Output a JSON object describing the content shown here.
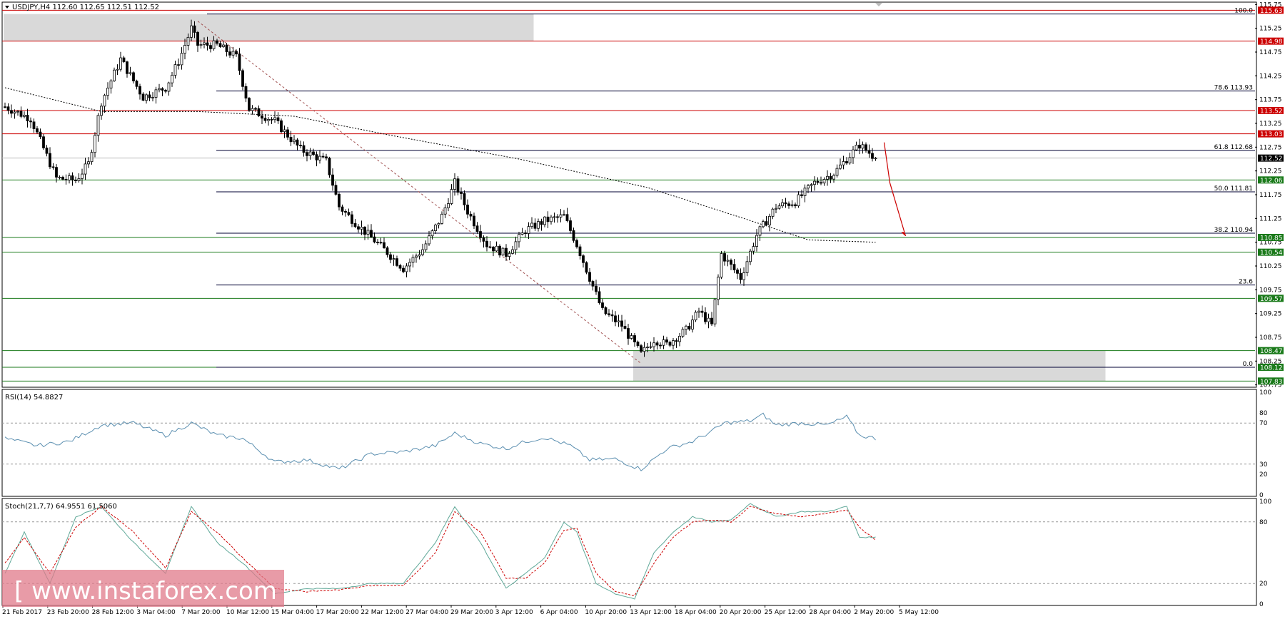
{
  "header": {
    "symbol_line": "USDJPY,H4  112.60 112.65 112.51 112.52"
  },
  "colors": {
    "bull": "#000000",
    "bear": "#000000",
    "resistance": "#cc0000",
    "support": "#1a7a1a",
    "fib": "#000033",
    "zone": "#d9d9d9",
    "rsi_line": "#5b8fb0",
    "stoch_main": "#5fa898",
    "stoch_signal": "#cc0000",
    "arrow": "#cc0000",
    "current": "#000000"
  },
  "chart_data": [
    {
      "type": "candlestick",
      "symbol": "USDJPY",
      "timeframe": "H4",
      "ohlc_header": {
        "open": 112.6,
        "high": 112.65,
        "low": 112.51,
        "close": 112.52
      },
      "ylim": [
        107.7,
        115.8
      ],
      "yticks": [
        107.75,
        108.25,
        108.75,
        109.25,
        109.75,
        110.25,
        110.75,
        111.25,
        111.75,
        112.25,
        112.75,
        113.25,
        113.75,
        114.25,
        114.75,
        115.25,
        115.75
      ],
      "x_labels": [
        "21 Feb 2017",
        "23 Feb 20:00",
        "28 Feb 12:00",
        "3 Mar 04:00",
        "7 Mar 20:00",
        "10 Mar 12:00",
        "15 Mar 04:00",
        "17 Mar 20:00",
        "22 Mar 12:00",
        "27 Mar 04:00",
        "29 Mar 20:00",
        "3 Apr 12:00",
        "6 Apr 04:00",
        "10 Apr 20:00",
        "13 Apr 12:00",
        "18 Apr 04:00",
        "20 Apr 20:00",
        "25 Apr 12:00",
        "28 Apr 04:00",
        "2 May 20:00",
        "5 May 12:00"
      ],
      "n_bars": 272,
      "anchors": [
        [
          0,
          113.6
        ],
        [
          8,
          113.35
        ],
        [
          16,
          112.1
        ],
        [
          22,
          112.05
        ],
        [
          26,
          112.4
        ],
        [
          30,
          113.7
        ],
        [
          36,
          114.6
        ],
        [
          43,
          113.8
        ],
        [
          50,
          114.0
        ],
        [
          54,
          114.55
        ],
        [
          58,
          115.25
        ],
        [
          60,
          114.9
        ],
        [
          66,
          114.9
        ],
        [
          72,
          114.65
        ],
        [
          76,
          113.55
        ],
        [
          84,
          113.3
        ],
        [
          92,
          112.7
        ],
        [
          100,
          112.45
        ],
        [
          104,
          111.5
        ],
        [
          110,
          111.1
        ],
        [
          118,
          110.6
        ],
        [
          124,
          110.2
        ],
        [
          130,
          110.6
        ],
        [
          136,
          111.3
        ],
        [
          140,
          112.0
        ],
        [
          144,
          111.4
        ],
        [
          150,
          110.7
        ],
        [
          156,
          110.5
        ],
        [
          162,
          111.0
        ],
        [
          168,
          111.2
        ],
        [
          174,
          111.3
        ],
        [
          178,
          110.7
        ],
        [
          182,
          110.0
        ],
        [
          186,
          109.3
        ],
        [
          192,
          109.0
        ],
        [
          198,
          108.4
        ],
        [
          202,
          108.7
        ],
        [
          206,
          108.6
        ],
        [
          212,
          108.9
        ],
        [
          216,
          109.3
        ],
        [
          220,
          109.0
        ],
        [
          223,
          110.5
        ],
        [
          229,
          110.0
        ],
        [
          234,
          110.9
        ],
        [
          240,
          111.5
        ],
        [
          246,
          111.6
        ],
        [
          252,
          112.0
        ],
        [
          258,
          112.2
        ],
        [
          262,
          112.5
        ],
        [
          266,
          112.8
        ],
        [
          271,
          112.52
        ]
      ],
      "forecast_arrow": {
        "from": 112.85,
        "mid": 112.0,
        "to": 110.88
      },
      "moving_average": {
        "anchors": [
          [
            0,
            114.0
          ],
          [
            30,
            113.5
          ],
          [
            60,
            113.5
          ],
          [
            90,
            113.4
          ],
          [
            120,
            113.0
          ],
          [
            160,
            112.5
          ],
          [
            200,
            111.9
          ],
          [
            230,
            111.25
          ],
          [
            250,
            110.8
          ],
          [
            271,
            110.75
          ]
        ]
      },
      "resistance_lines": [
        {
          "price": 115.63,
          "label": "115.63"
        },
        {
          "price": 114.98,
          "label": "114.98"
        },
        {
          "price": 113.52,
          "label": "113.52"
        },
        {
          "price": 113.03,
          "label": "113.03"
        }
      ],
      "support_lines": [
        {
          "price": 112.06,
          "label": "112.06"
        },
        {
          "price": 110.85,
          "label": "110.85"
        },
        {
          "price": 110.54,
          "label": "110.54"
        },
        {
          "price": 109.57,
          "label": "109.57"
        },
        {
          "price": 108.47,
          "label": "108.47"
        },
        {
          "price": 108.12,
          "label": "108.12"
        },
        {
          "price": 107.83,
          "label": "107.83"
        }
      ],
      "current_price": {
        "price": 112.52,
        "label": "112.52"
      },
      "fib_levels": [
        {
          "price": 115.55,
          "label": "100.0"
        },
        {
          "price": 113.93,
          "label": "78.6 113.93"
        },
        {
          "price": 112.68,
          "label": "61.8 112.68"
        },
        {
          "price": 111.81,
          "label": "50.0 111.81"
        },
        {
          "price": 110.94,
          "label": "38.2 110.94"
        },
        {
          "price": 109.85,
          "label": "23.6"
        },
        {
          "price": 108.12,
          "label": "0.0"
        }
      ],
      "zones": [
        {
          "from_bar": 0,
          "to_bar": 165,
          "low": 114.98,
          "high": 115.55
        },
        {
          "from_bar": 196,
          "to_bar": 343,
          "low": 107.83,
          "high": 108.47
        }
      ],
      "trendline": {
        "from": [
          60,
          115.4
        ],
        "to": [
          198,
          108.2
        ]
      }
    },
    {
      "type": "line",
      "indicator": "RSI",
      "title": "RSI(14) 54.8827",
      "ylim": [
        0,
        100
      ],
      "yticks": [
        100,
        80,
        70,
        30,
        20,
        0
      ],
      "levels": [
        70,
        30
      ],
      "anchors": [
        [
          0,
          55
        ],
        [
          10,
          48
        ],
        [
          20,
          52
        ],
        [
          30,
          68
        ],
        [
          40,
          70
        ],
        [
          50,
          58
        ],
        [
          58,
          70
        ],
        [
          66,
          58
        ],
        [
          74,
          55
        ],
        [
          84,
          32
        ],
        [
          94,
          34
        ],
        [
          104,
          25
        ],
        [
          114,
          40
        ],
        [
          124,
          42
        ],
        [
          134,
          48
        ],
        [
          140,
          60
        ],
        [
          148,
          50
        ],
        [
          156,
          45
        ],
        [
          162,
          52
        ],
        [
          168,
          56
        ],
        [
          176,
          48
        ],
        [
          182,
          34
        ],
        [
          190,
          35
        ],
        [
          198,
          25
        ],
        [
          206,
          45
        ],
        [
          214,
          52
        ],
        [
          220,
          62
        ],
        [
          224,
          70
        ],
        [
          232,
          72
        ],
        [
          236,
          78
        ],
        [
          240,
          68
        ],
        [
          248,
          70
        ],
        [
          256,
          68
        ],
        [
          262,
          76
        ],
        [
          266,
          58
        ],
        [
          271,
          55
        ]
      ]
    },
    {
      "type": "line",
      "indicator": "Stochastic",
      "title": "Stoch(21,7,7) 64.9551 61.5060",
      "ylim": [
        0,
        100
      ],
      "yticks": [
        100,
        80,
        20,
        0
      ],
      "levels": [
        80,
        20
      ],
      "main_anchors": [
        [
          0,
          30
        ],
        [
          6,
          70
        ],
        [
          14,
          20
        ],
        [
          22,
          85
        ],
        [
          30,
          95
        ],
        [
          40,
          60
        ],
        [
          50,
          30
        ],
        [
          58,
          95
        ],
        [
          66,
          60
        ],
        [
          74,
          40
        ],
        [
          84,
          10
        ],
        [
          94,
          15
        ],
        [
          104,
          15
        ],
        [
          114,
          20
        ],
        [
          124,
          20
        ],
        [
          134,
          60
        ],
        [
          140,
          95
        ],
        [
          148,
          60
        ],
        [
          156,
          15
        ],
        [
          162,
          30
        ],
        [
          168,
          45
        ],
        [
          174,
          80
        ],
        [
          178,
          70
        ],
        [
          184,
          20
        ],
        [
          190,
          10
        ],
        [
          196,
          5
        ],
        [
          202,
          50
        ],
        [
          208,
          70
        ],
        [
          214,
          85
        ],
        [
          220,
          80
        ],
        [
          226,
          82
        ],
        [
          232,
          98
        ],
        [
          240,
          85
        ],
        [
          248,
          90
        ],
        [
          256,
          90
        ],
        [
          262,
          95
        ],
        [
          266,
          65
        ],
        [
          271,
          65
        ]
      ],
      "signal_anchors": [
        [
          0,
          40
        ],
        [
          6,
          65
        ],
        [
          14,
          30
        ],
        [
          22,
          75
        ],
        [
          30,
          95
        ],
        [
          40,
          70
        ],
        [
          50,
          35
        ],
        [
          58,
          90
        ],
        [
          66,
          70
        ],
        [
          74,
          45
        ],
        [
          84,
          15
        ],
        [
          94,
          12
        ],
        [
          104,
          14
        ],
        [
          114,
          18
        ],
        [
          124,
          18
        ],
        [
          134,
          50
        ],
        [
          140,
          90
        ],
        [
          148,
          70
        ],
        [
          156,
          25
        ],
        [
          162,
          25
        ],
        [
          168,
          40
        ],
        [
          174,
          72
        ],
        [
          178,
          74
        ],
        [
          184,
          30
        ],
        [
          190,
          12
        ],
        [
          196,
          8
        ],
        [
          202,
          40
        ],
        [
          208,
          65
        ],
        [
          214,
          80
        ],
        [
          220,
          82
        ],
        [
          226,
          80
        ],
        [
          232,
          95
        ],
        [
          240,
          88
        ],
        [
          248,
          85
        ],
        [
          256,
          88
        ],
        [
          262,
          92
        ],
        [
          266,
          75
        ],
        [
          271,
          62
        ]
      ]
    }
  ],
  "watermark": {
    "text": "[ www.instaforex.com ]"
  }
}
